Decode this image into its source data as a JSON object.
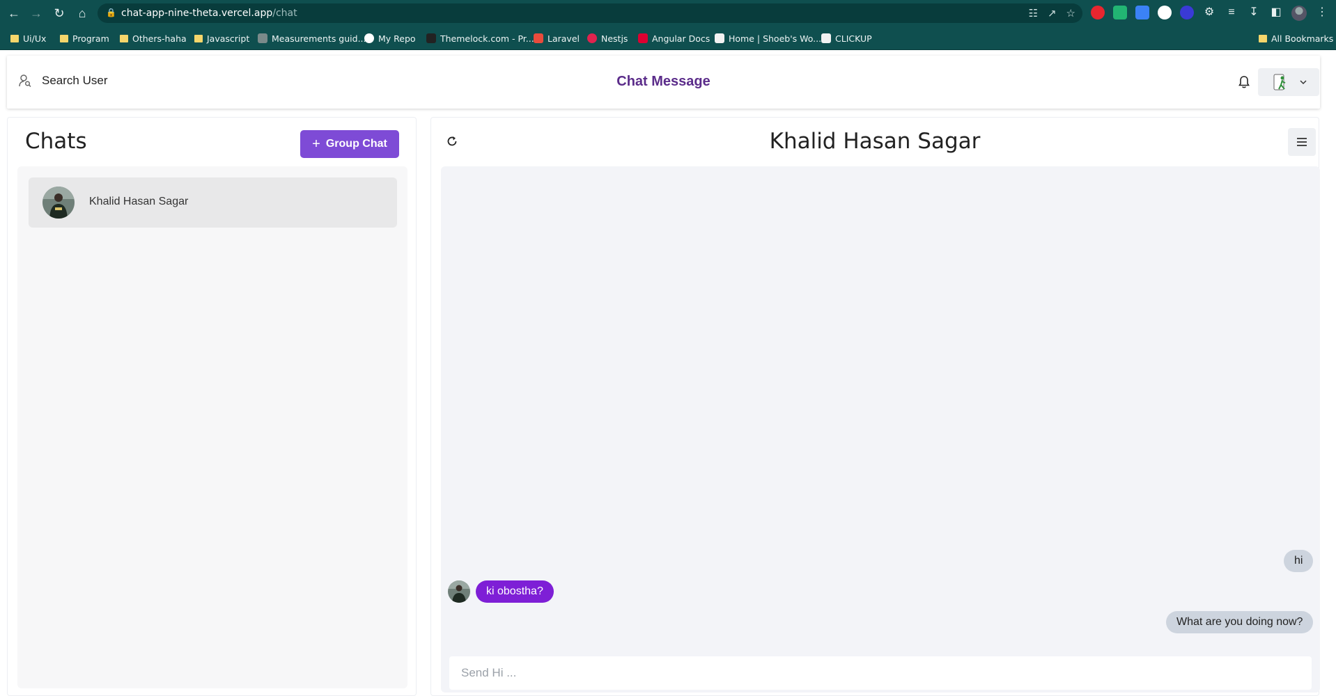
{
  "browser": {
    "url_host": "chat-app-nine-theta.vercel.app",
    "url_path": "/chat",
    "bookmarks": [
      {
        "label": "Ui/Ux",
        "icon": "folder-icon"
      },
      {
        "label": "Program",
        "icon": "folder-icon"
      },
      {
        "label": "Others-haha",
        "icon": "folder-icon"
      },
      {
        "label": "Javascript",
        "icon": "folder-icon"
      },
      {
        "label": "Measurements guid...",
        "icon": "measure-icon"
      },
      {
        "label": "My Repo",
        "icon": "github-icon"
      },
      {
        "label": "Themelock.com - Pr...",
        "icon": "themelock-icon"
      },
      {
        "label": "Laravel",
        "icon": "laravel-icon"
      },
      {
        "label": "Nestjs",
        "icon": "nestjs-icon"
      },
      {
        "label": "Angular Docs",
        "icon": "angular-icon"
      },
      {
        "label": "Home | Shoeb's Wo...",
        "icon": "clickup-icon"
      },
      {
        "label": "CLICKUP",
        "icon": "clickup-icon"
      }
    ],
    "all_bookmarks": "All Bookmarks"
  },
  "header": {
    "search_label": "Search User",
    "title": "Chat Message"
  },
  "sidebar": {
    "title": "Chats",
    "group_button": "Group Chat",
    "chats": [
      {
        "name": "Khalid Hasan Sagar"
      }
    ]
  },
  "chat": {
    "title": "Khalid Hasan Sagar",
    "messages": [
      {
        "text": "hi",
        "side": "right"
      },
      {
        "text": "ki obostha?",
        "side": "left"
      },
      {
        "text": "What are you doing now?",
        "side": "right"
      }
    ],
    "input_placeholder": "Send Hi ..."
  },
  "colors": {
    "accent": "#7e4bd6",
    "title_purple": "#5b2c8a",
    "incoming_bubble": "#7e1fd6",
    "outgoing_bubble": "#cdd4de",
    "chrome": "#0f4f4f"
  }
}
